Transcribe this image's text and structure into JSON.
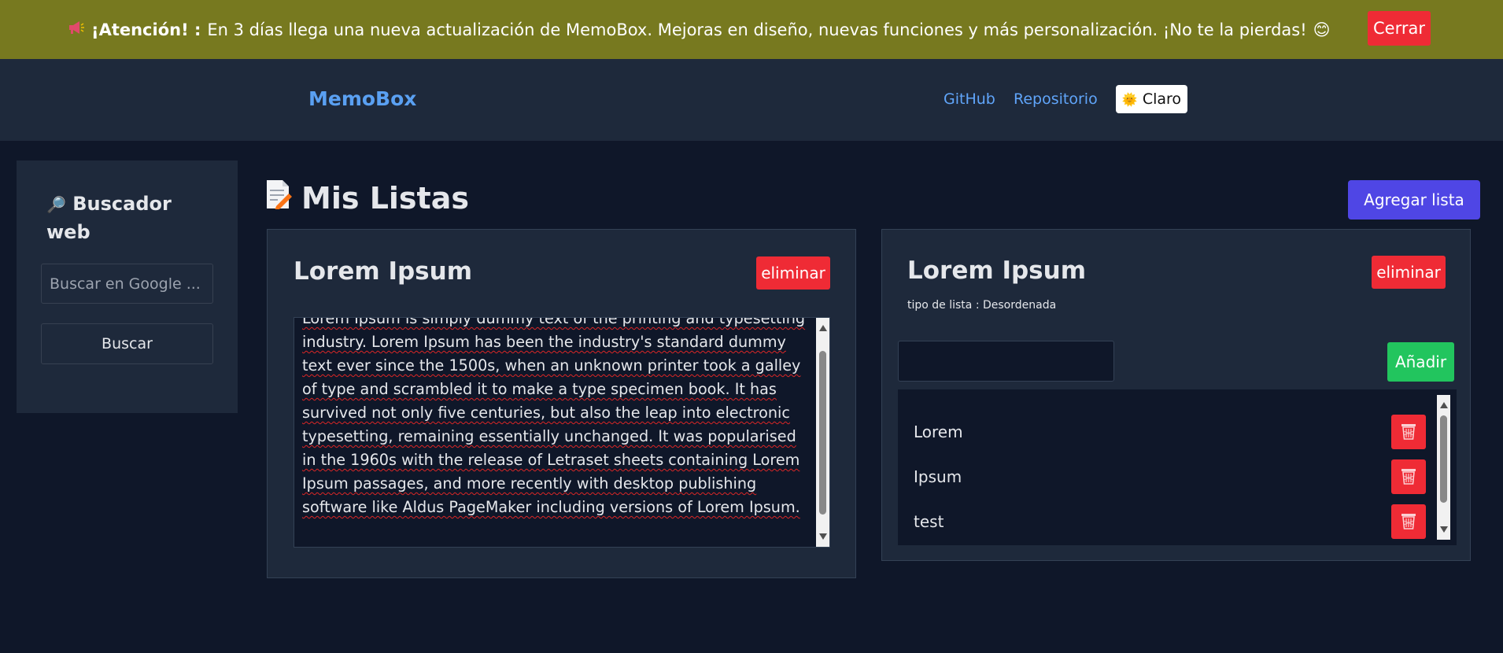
{
  "banner": {
    "prefix": "¡Atención! :",
    "message": "En 3 días llega una nueva actualización de MemoBox. Mejoras en diseño, nuevas funciones y más personalización. ¡No te la pierdas!",
    "close_label": "Cerrar",
    "icon": "megaphone-icon",
    "emoji": "😊"
  },
  "navbar": {
    "brand": "MemoBox",
    "links": [
      "GitHub",
      "Repositorio"
    ],
    "theme_label": "Claro",
    "theme_icon": "🌞"
  },
  "sidebar": {
    "title": "Buscador web",
    "title_icon": "🔎",
    "search_placeholder": "Buscar en Google ...",
    "search_button": "Buscar"
  },
  "main": {
    "title": "Mis Listas",
    "title_icon": "memo-icon",
    "add_list_label": "Agregar lista",
    "lists": [
      {
        "title": "Lorem Ipsum",
        "delete_label": "eliminar",
        "text": "Lorem Ipsum is simply dummy text of the printing and typesetting industry. Lorem Ipsum has been the industry's standard dummy text ever since the 1500s, when an unknown printer took a galley of type and scrambled it to make a type specimen book. It has survived not only five centuries, but also the leap into electronic typesetting, remaining essentially unchanged. It was popularised in the 1960s with the release of Letraset sheets containing Lorem Ipsum passages, and more recently with desktop publishing software like Aldus PageMaker including versions of Lorem Ipsum."
      },
      {
        "title": "Lorem Ipsum",
        "delete_label": "eliminar",
        "subtitle": "tipo de lista : Desordenada",
        "input_value": "",
        "add_label": "Añadir",
        "items": [
          "Lorem",
          "Ipsum",
          "test"
        ]
      }
    ]
  },
  "colors": {
    "banner": "#77791f",
    "danger": "#ef2b35",
    "primary": "#4f46e5",
    "success": "#22c55e",
    "brand": "#5aa0f2"
  }
}
